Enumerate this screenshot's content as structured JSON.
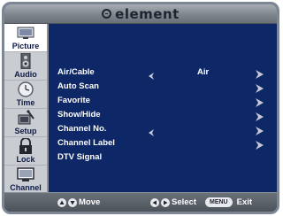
{
  "brand": {
    "name": "element"
  },
  "sidebar": {
    "items": [
      {
        "label": "Picture",
        "icon": "picture-icon",
        "active": true
      },
      {
        "label": "Audio",
        "icon": "speaker-icon",
        "active": false
      },
      {
        "label": "Time",
        "icon": "clock-icon",
        "active": false
      },
      {
        "label": "Setup",
        "icon": "setup-icon",
        "active": false
      },
      {
        "label": "Lock",
        "icon": "lock-icon",
        "active": false
      },
      {
        "label": "Channel",
        "icon": "channel-icon",
        "active": false
      }
    ]
  },
  "menu": {
    "rows": [
      {
        "label": "Air/Cable",
        "value": "Air",
        "left_arrow": true,
        "right_arrow": true
      },
      {
        "label": "Auto Scan",
        "value": "",
        "left_arrow": false,
        "right_arrow": true
      },
      {
        "label": "Favorite",
        "value": "",
        "left_arrow": false,
        "right_arrow": true
      },
      {
        "label": "Show/Hide",
        "value": "",
        "left_arrow": false,
        "right_arrow": true
      },
      {
        "label": "Channel No.",
        "value": "",
        "left_arrow": true,
        "right_arrow": true
      },
      {
        "label": "Channel Label",
        "value": "",
        "left_arrow": false,
        "right_arrow": true
      },
      {
        "label": "DTV Signal",
        "value": "",
        "left_arrow": false,
        "right_arrow": false
      }
    ]
  },
  "footer": {
    "move_label": "Move",
    "select_label": "Select",
    "menu_key": "MENU",
    "exit_label": "Exit"
  },
  "colors": {
    "panel_bg": "#0e2766",
    "sidebar_bg": "#c9ccd1",
    "frame": "#7d8793",
    "text": "#ffffff"
  }
}
